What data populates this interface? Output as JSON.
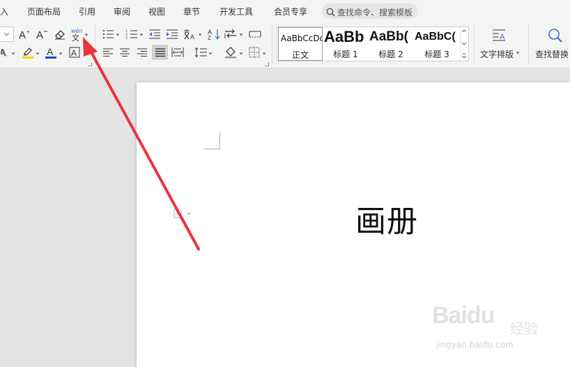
{
  "menubar": {
    "tabs": [
      "入",
      "页面布局",
      "引用",
      "审阅",
      "视图",
      "章节",
      "开发工具",
      "会员专享"
    ],
    "search_placeholder": "查找命令、搜索模板"
  },
  "ribbon": {
    "styles": [
      {
        "sample": "AaBbCcDd",
        "label": "正文"
      },
      {
        "sample": "AaBb",
        "label": "标题 1"
      },
      {
        "sample": "AaBb(",
        "label": "标题 2"
      },
      {
        "sample": "AaBbC(",
        "label": "标题 3"
      }
    ],
    "text_layout_label": "文字排版",
    "find_replace_label": "查找替换"
  },
  "document": {
    "body_text": "画册"
  },
  "watermark": {
    "brand": "Baidu",
    "brand_sub": "经验",
    "url": "jingyan.baidu.com"
  },
  "colors": {
    "annotation_arrow": "#e8343a",
    "highlight_yellow": "#f5d800",
    "font_color_blue": "#1f3fd6",
    "icon_blue": "#3a6fc4"
  }
}
